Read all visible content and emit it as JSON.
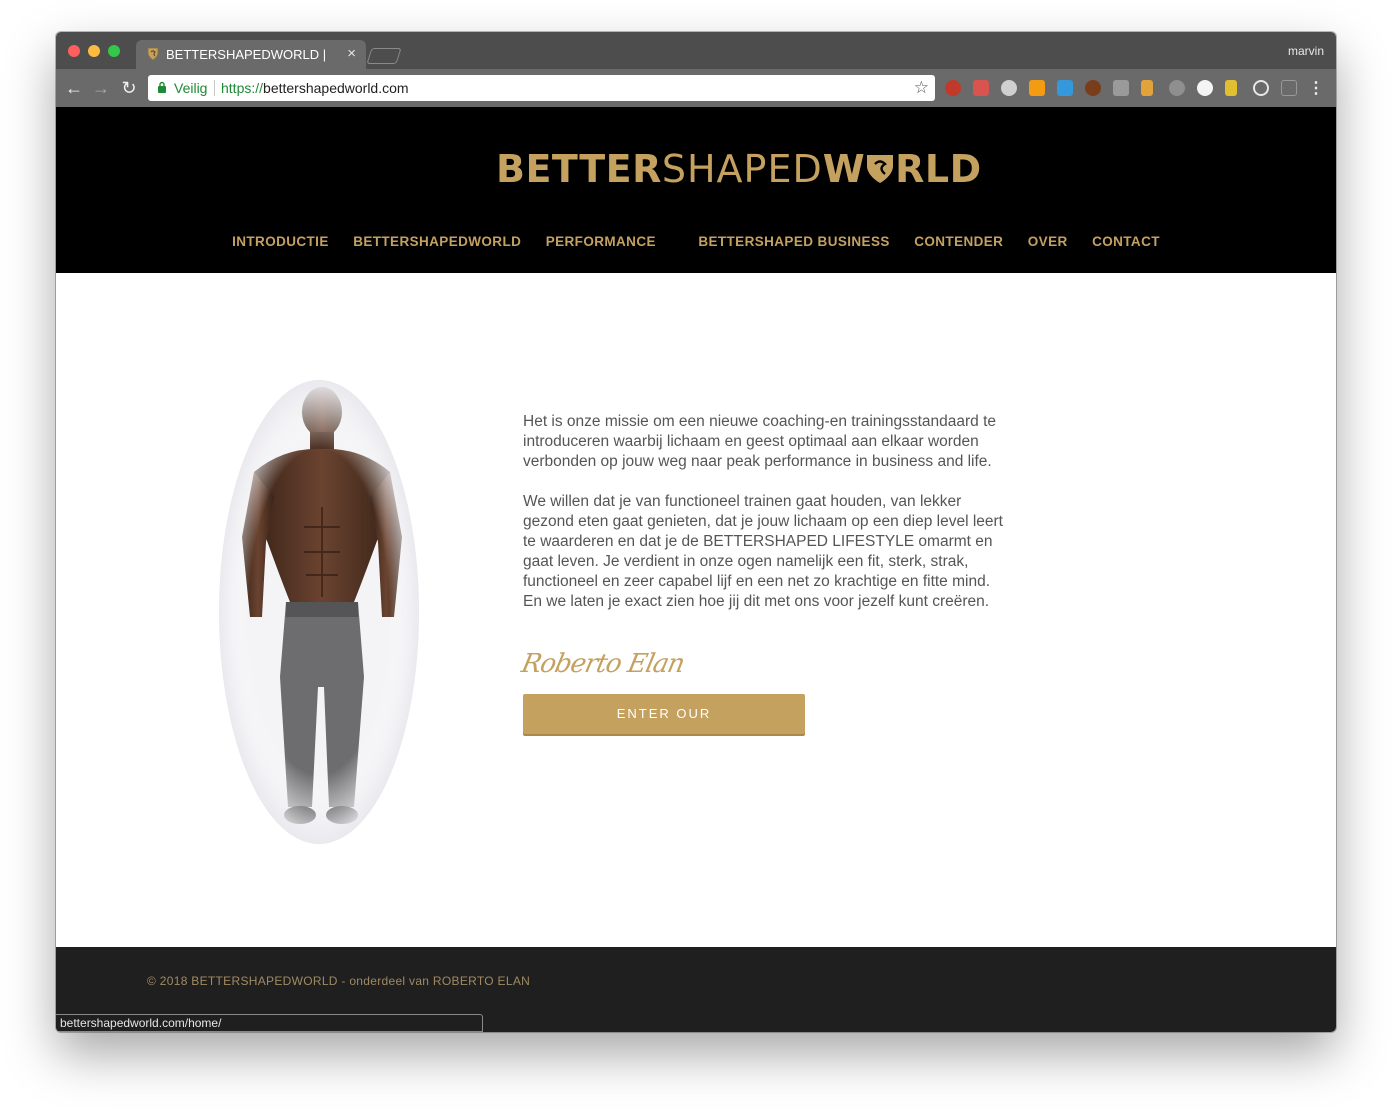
{
  "browser": {
    "tab_title": "BETTERSHAPEDWORLD |",
    "tab_close": "×",
    "profile_name": "marvin",
    "secure_label": "Veilig",
    "url_scheme": "https://",
    "url_host": "bettershapedworld.com",
    "status_url": "bettershapedworld.com/home/",
    "extensions": [
      "abp-icon",
      "calendar-badge-icon",
      "gear-extension-icon",
      "music-icon",
      "weather-icon",
      "mustache-icon",
      "camera-icon",
      "ruler-icon",
      "settings-extension-icon",
      "opera-icon",
      "shield-extension-icon",
      "react-icon",
      "json-icon"
    ]
  },
  "site": {
    "logo_bold": "BETTER",
    "logo_thin": "SHAPED",
    "logo_bold2": "W",
    "logo_bold3": "RLD",
    "nav": [
      "INTRODUCTIE",
      "BETTERSHAPEDWORLD",
      "PERFORMANCE",
      "BETTERSHAPED BUSINESS",
      "CONTENDER",
      "OVER",
      "CONTACT"
    ],
    "intro_p1": "Het is onze missie om een nieuwe coaching-en trainingsstandaard te introduceren waarbij lichaam en geest optimaal aan elkaar worden verbonden op jouw weg naar peak performance in business and life.",
    "intro_p2": "We willen dat je van functioneel trainen gaat houden, van lekker gezond eten gaat genieten, dat je jouw lichaam op een diep level leert te waarderen en dat je de BETTERSHAPED LIFESTYLE omarmt en gaat leven. Je verdient in onze ogen namelijk een fit, sterk, strak, functioneel en zeer capabel lijf en een net zo krachtige en fitte mind. En we laten je exact zien hoe jij dit met ons voor jezelf kunt creëren.",
    "signature": "Roberto Elan",
    "cta_label": "ENTER OUR BETTERSHAPEDWORLD",
    "footer_text": "© 2018 BETTERSHAPEDWORLD - onderdeel van ROBERTO ELAN"
  },
  "colors": {
    "gold": "#c4a15f",
    "header_bg": "#000000",
    "footer_bg": "#1f1f1f"
  }
}
